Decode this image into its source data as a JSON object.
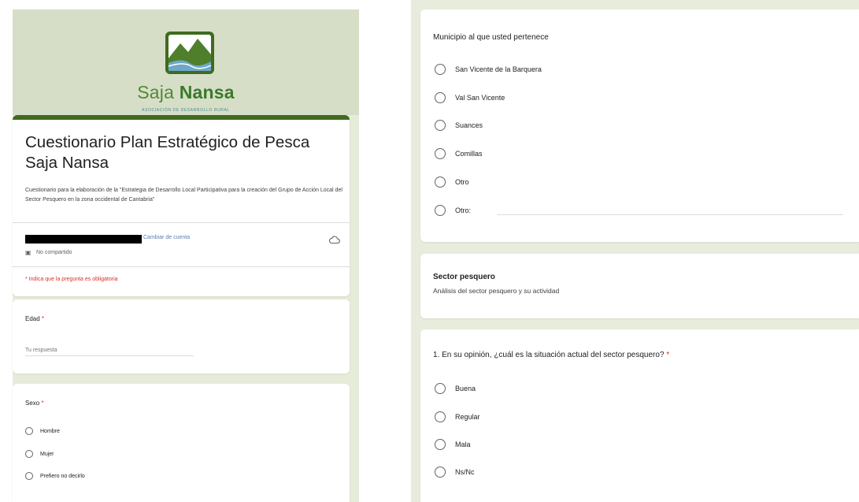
{
  "form": {
    "logo": {
      "brand_light": "Saja",
      "brand_bold": "Nansa",
      "subtitle": "ASOCIACIÓN DE DESARROLLO RURAL"
    },
    "title": "Cuestionario Plan Estratégico de Pesca Saja Nansa",
    "description": "Cuestionario para la elaboración de la \"Estrategia de Desarrollo Local Participativa para la creación del Grupo de Acción Local del Sector Pesquero en la zona occidental de Cantabria\"",
    "account": {
      "change_label": "Cambiar de cuenta",
      "not_shared": "No compartido"
    },
    "required_note": "* Indica que la pregunta es obligatoria"
  },
  "questions": {
    "edad": {
      "label": "Edad",
      "required_mark": "*",
      "placeholder": "Tu respuesta"
    },
    "sexo": {
      "label": "Sexo",
      "required_mark": "*",
      "options": [
        "Hombre",
        "Mujer",
        "Prefiero no decirlo"
      ]
    },
    "municipio": {
      "label": "Municipio al que usted pertenece",
      "options": [
        "San Vicente de la Barquera",
        "Val San Vicente",
        "Suances",
        "Comillas",
        "Otro",
        "Otro:"
      ]
    },
    "sector": {
      "title": "Sector pesquero",
      "description": "Análisis del sector pesquero y su actividad"
    },
    "q1": {
      "label": "1. En su opinión, ¿cuál es la situación actual del sector pesquero?",
      "required_mark": "*",
      "options": [
        "Buena",
        "Regular",
        "Mala",
        "Ns/Nc"
      ]
    }
  },
  "colors": {
    "accent_green": "#3f6b1f",
    "header_bg": "#d7dec7",
    "page_bg": "#e6ecd9",
    "required_red": "#d93025",
    "link_blue": "#5b7fb0"
  },
  "icons": [
    "saja-nansa-logo-icon",
    "cloud-icon",
    "not-shared-icon",
    "radio-button-icon"
  ]
}
